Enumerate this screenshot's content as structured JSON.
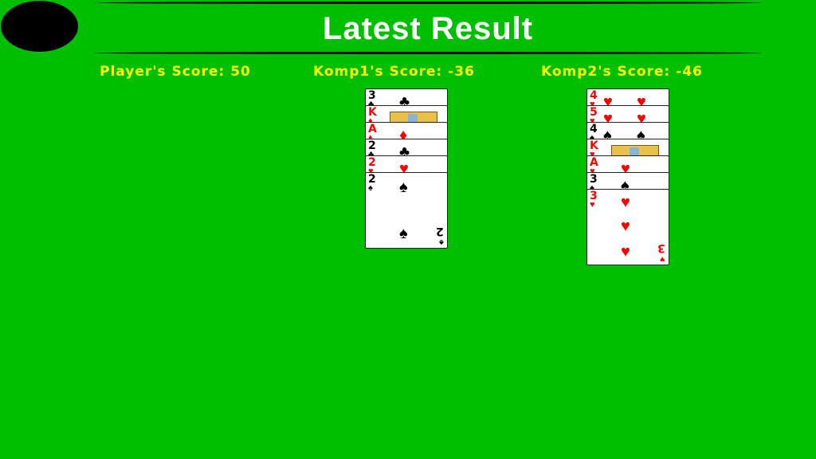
{
  "title": "Latest Result",
  "scores": {
    "player": "Player's Score: 50",
    "komp1": "Komp1's Score: -36",
    "komp2": "Komp2's Score: -46"
  },
  "colors": {
    "table": "#00bf00",
    "title": "#ffffff",
    "scores": "#ffff00",
    "red_suit": "#ff0000",
    "black_suit": "#000000"
  },
  "piles": [
    {
      "name": "komp1-pile",
      "cards": [
        {
          "rank": "3",
          "suit": "♣",
          "color": "black"
        },
        {
          "rank": "K",
          "suit": "♦",
          "color": "red",
          "face": true
        },
        {
          "rank": "A",
          "suit": "♦",
          "color": "red"
        },
        {
          "rank": "2",
          "suit": "♣",
          "color": "black"
        },
        {
          "rank": "2",
          "suit": "♥",
          "color": "red"
        },
        {
          "rank": "2",
          "suit": "♠",
          "color": "black"
        }
      ]
    },
    {
      "name": "komp2-pile",
      "cards": [
        {
          "rank": "4",
          "suit": "♥",
          "color": "red"
        },
        {
          "rank": "5",
          "suit": "♥",
          "color": "red"
        },
        {
          "rank": "4",
          "suit": "♠",
          "color": "black"
        },
        {
          "rank": "K",
          "suit": "♥",
          "color": "red",
          "face": true
        },
        {
          "rank": "A",
          "suit": "♥",
          "color": "red"
        },
        {
          "rank": "3",
          "suit": "♠",
          "color": "black"
        },
        {
          "rank": "3",
          "suit": "♥",
          "color": "red"
        }
      ]
    }
  ]
}
